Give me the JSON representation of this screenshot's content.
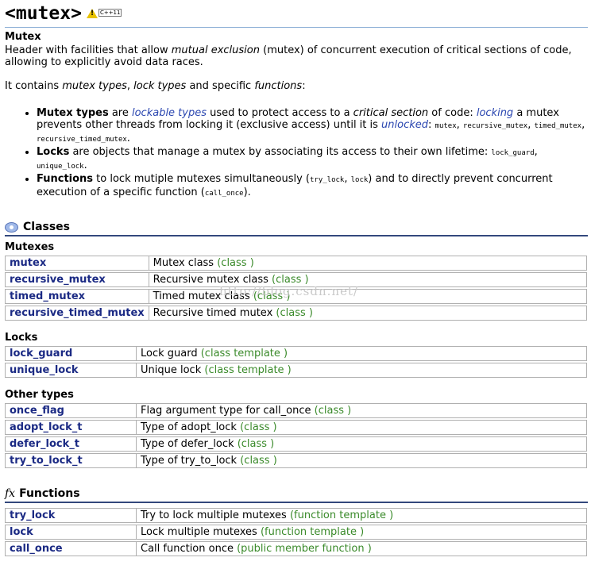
{
  "header": {
    "title": "<mutex>",
    "badge": "C++11"
  },
  "mutex": {
    "heading": "Mutex",
    "intro": [
      "Header with facilities that allow ",
      "mutual exclusion",
      " (mutex) of concurrent execution of critical sections of code, allowing to explicitly avoid data races."
    ],
    "contains": [
      "It contains ",
      "mutex types",
      ", ",
      "lock types",
      " and specific ",
      "functions",
      ":"
    ],
    "bullets": {
      "mutex_types": {
        "label": "Mutex types",
        "t1": " are ",
        "l1": "lockable types",
        "t2": " used to protect access to a ",
        "l2": "critical section",
        "t3": " of code: ",
        "l3": "locking",
        "t4": " a mutex prevents other threads from locking it (exclusive access) until it is ",
        "l4": "unlocked",
        "t5": ": ",
        "c1": "mutex",
        "s1": ", ",
        "c2": "recursive_mutex",
        "s2": ", ",
        "c3": "timed_mutex",
        "s3": ", ",
        "c4": "recursive_timed_mutex",
        "end": "."
      },
      "locks": {
        "label": "Locks",
        "t1": " are objects that manage a mutex by associating its access to their own lifetime: ",
        "c1": "lock_guard",
        "s1": ", ",
        "c2": "unique_lock",
        "end": "."
      },
      "functions": {
        "label": "Functions",
        "t1": " to lock mutiple mutexes simultaneously (",
        "c1": "try_lock",
        "s1": ", ",
        "c2": "lock",
        "t2": ") and to directly prevent concurrent execution of a specific function (",
        "c3": "call_once",
        "end": ")."
      }
    }
  },
  "classes": {
    "title": "Classes",
    "groups": [
      {
        "name": "Mutexes",
        "rows": [
          {
            "name": "mutex",
            "desc": "Mutex class ",
            "kind": "(class )"
          },
          {
            "name": "recursive_mutex",
            "desc": "Recursive mutex class ",
            "kind": "(class )"
          },
          {
            "name": "timed_mutex",
            "desc": "Timed mutex class ",
            "kind": "(class )"
          },
          {
            "name": "recursive_timed_mutex",
            "desc": "Recursive timed mutex ",
            "kind": "(class )"
          }
        ]
      },
      {
        "name": "Locks",
        "rows": [
          {
            "name": "lock_guard",
            "desc": "Lock guard ",
            "kind": "(class template )"
          },
          {
            "name": "unique_lock",
            "desc": "Unique lock ",
            "kind": "(class template )"
          }
        ]
      },
      {
        "name": "Other types",
        "rows": [
          {
            "name": "once_flag",
            "desc": "Flag argument type for call_once ",
            "kind": "(class )"
          },
          {
            "name": "adopt_lock_t",
            "desc": "Type of adopt_lock ",
            "kind": "(class )"
          },
          {
            "name": "defer_lock_t",
            "desc": "Type of defer_lock ",
            "kind": "(class )"
          },
          {
            "name": "try_to_lock_t",
            "desc": "Type of try_to_lock ",
            "kind": "(class )"
          }
        ]
      }
    ]
  },
  "functions": {
    "icon": "fx",
    "title": "Functions",
    "rows": [
      {
        "name": "try_lock",
        "desc": "Try to lock multiple mutexes ",
        "kind": "(function template )"
      },
      {
        "name": "lock",
        "desc": "Lock multiple mutexes ",
        "kind": "(function template )"
      },
      {
        "name": "call_once",
        "desc": "Call function once ",
        "kind": "(public member function )"
      }
    ]
  },
  "watermark": "http://blog.csdn.net/"
}
